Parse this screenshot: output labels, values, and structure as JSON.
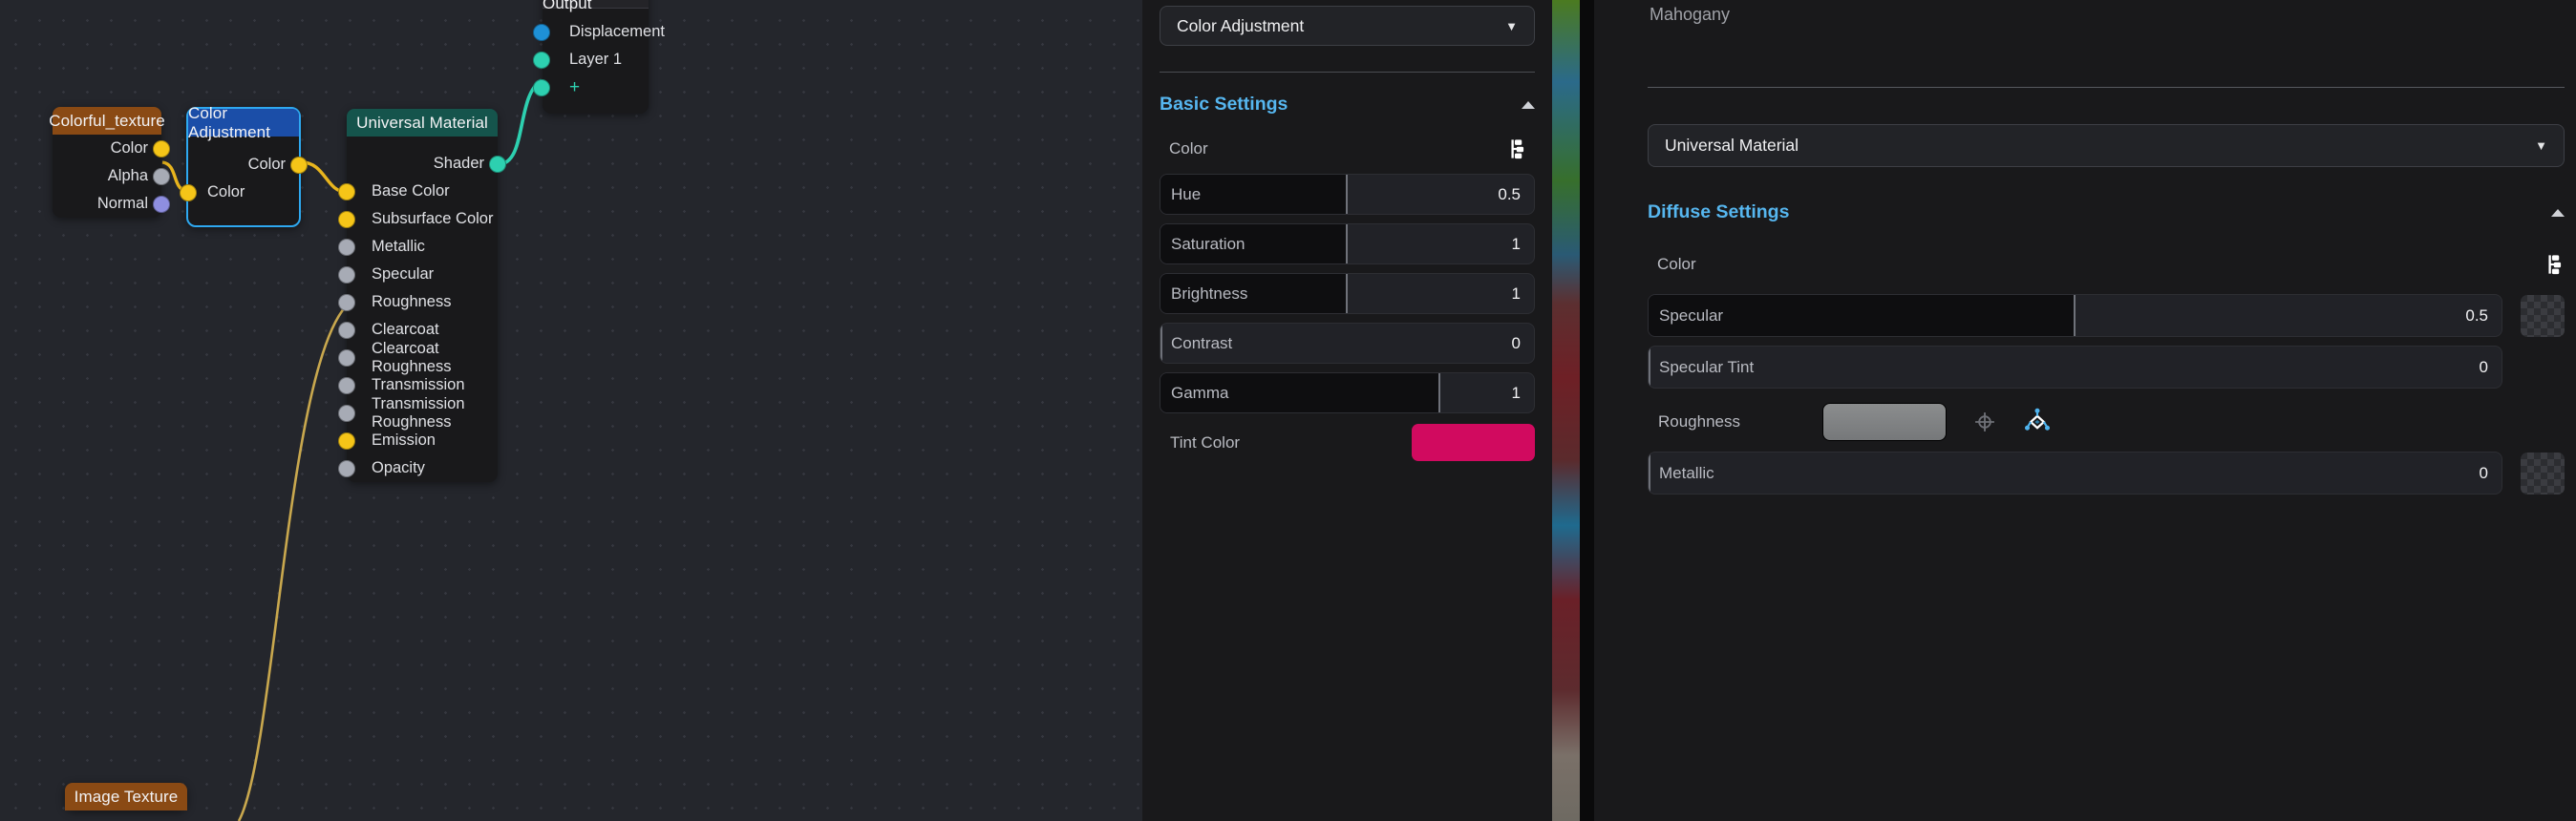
{
  "node_editor": {
    "nodes": [
      {
        "name": "Colorful_texture",
        "header_color": "#8a4a14",
        "outputs": [
          {
            "label": "Color",
            "socket": "color"
          }
        ],
        "inputs": [
          {
            "label": "Alpha",
            "socket": "gray"
          },
          {
            "label": "Normal",
            "socket": "purple"
          }
        ]
      },
      {
        "name": "Color Adjustment",
        "header_color": "#1b4ea8",
        "selected": true,
        "outputs": [
          {
            "label": "Color",
            "socket": "color"
          }
        ],
        "inputs": [
          {
            "label": "Color",
            "socket": "color"
          }
        ]
      },
      {
        "name": "Universal Material",
        "header_color": "#15544c",
        "outputs": [
          {
            "label": "Shader",
            "socket": "teal"
          }
        ],
        "inputs": [
          {
            "label": "Base Color",
            "socket": "color"
          },
          {
            "label": "Subsurface Color",
            "socket": "color"
          },
          {
            "label": "Metallic",
            "socket": "gray"
          },
          {
            "label": "Specular",
            "socket": "gray"
          },
          {
            "label": "Roughness",
            "socket": "gray"
          },
          {
            "label": "Clearcoat",
            "socket": "gray"
          },
          {
            "label": "Clearcoat Roughness",
            "socket": "gray"
          },
          {
            "label": "Transmission",
            "socket": "gray"
          },
          {
            "label": "Transmission Roughness",
            "socket": "gray"
          },
          {
            "label": "Emission",
            "socket": "color"
          },
          {
            "label": "Opacity",
            "socket": "gray"
          }
        ]
      },
      {
        "name": "Material Output",
        "header_color": "#242428",
        "inputs": [
          {
            "label": "Displacement",
            "socket": "blue"
          },
          {
            "label": "Layer 1",
            "socket": "teal"
          },
          {
            "label": "+",
            "socket": "teal"
          }
        ]
      },
      {
        "name": "Image Texture",
        "header_color": "#8a4a14",
        "inputs": [],
        "outputs": []
      }
    ]
  },
  "center_panel": {
    "node_selector": {
      "value": "Color Adjustment",
      "caret": "chevron-down-icon"
    },
    "section": {
      "title": "Basic Settings",
      "collapse": "chevron-up-icon"
    },
    "color_row": {
      "label": "Color",
      "icon": "node-link-icon"
    },
    "sliders": [
      {
        "label": "Hue",
        "value": "0.5",
        "fill_pct": 50
      },
      {
        "label": "Saturation",
        "value": "1",
        "fill_pct": 50
      },
      {
        "label": "Brightness",
        "value": "1",
        "fill_pct": 50
      },
      {
        "label": "Contrast",
        "value": "0",
        "fill_pct": 0
      },
      {
        "label": "Gamma",
        "value": "1",
        "fill_pct": 75
      }
    ],
    "tint": {
      "label": "Tint Color",
      "color": "#d10a5f"
    }
  },
  "right_panel": {
    "material_name": "Mahogany",
    "material_type": {
      "value": "Universal Material",
      "caret": "chevron-down-icon"
    },
    "section": {
      "title": "Diffuse Settings",
      "collapse": "chevron-up-icon"
    },
    "color_row": {
      "label": "Color",
      "icon": "node-link-icon"
    },
    "rows": [
      {
        "label": "Specular",
        "value": "0.5",
        "fill_pct": 50,
        "trailing": "checker-swatch"
      },
      {
        "label": "Specular Tint",
        "value": "0",
        "fill_pct": 0,
        "trailing": "none"
      },
      {
        "label": "Roughness",
        "value": "",
        "trailing": "texture-swatch",
        "icons": [
          "target-icon",
          "node-graph-icon"
        ]
      },
      {
        "label": "Metallic",
        "value": "0",
        "fill_pct": 0,
        "trailing": "checker-swatch"
      }
    ]
  },
  "colors": {
    "accent_blue": "#56b6ef",
    "socket_color": "#f5c518",
    "socket_gray": "#a7abb5",
    "socket_teal": "#2dd0b0",
    "socket_blue": "#1e90d6",
    "tint": "#d10a5f"
  }
}
